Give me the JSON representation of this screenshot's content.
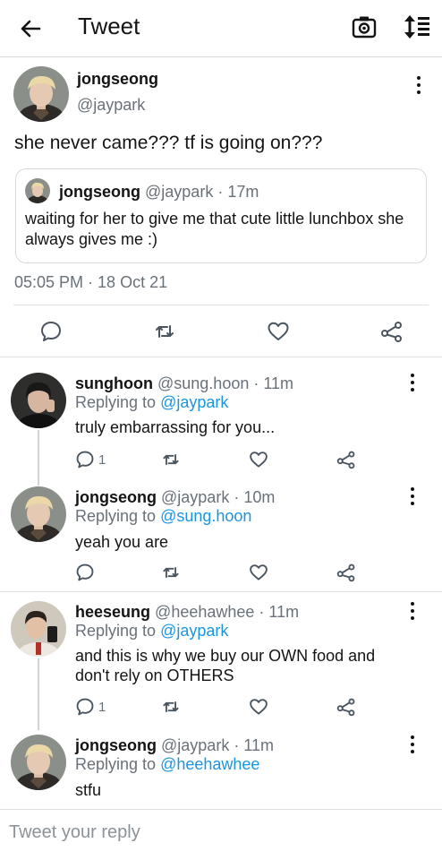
{
  "header": {
    "title": "Tweet"
  },
  "tweet": {
    "author_name": "jongseong",
    "author_handle": "@jaypark",
    "text": "she never came??? tf is going on???",
    "quoted": {
      "author_name": "jongseong",
      "author_handle": "@jaypark",
      "time": "· 17m",
      "text": "waiting for her to give me that cute little lunchbox she always gives me :)"
    },
    "timestamp": "05:05 PM · 18 Oct 21"
  },
  "replies": [
    {
      "name": "sunghoon",
      "handle": "@sung.hoon",
      "time": "· 11m",
      "replying_label": "Replying to",
      "replying_to": "@jaypark",
      "text": "truly embarrassing for you...",
      "reply_count": "1"
    },
    {
      "name": "jongseong",
      "handle": "@jaypark",
      "time": "· 10m",
      "replying_label": "Replying to",
      "replying_to": "@sung.hoon",
      "text": "yeah you are",
      "reply_count": ""
    },
    {
      "name": "heeseung",
      "handle": "@heehawhee",
      "time": "· 11m",
      "replying_label": "Replying to",
      "replying_to": "@jaypark",
      "text": "and this is why we buy our OWN food and don't rely on OTHERS",
      "reply_count": "1"
    },
    {
      "name": "jongseong",
      "handle": "@jaypark",
      "time": "· 11m",
      "replying_label": "Replying to",
      "replying_to": "@heehawhee",
      "text": "stfu",
      "reply_count": ""
    }
  ],
  "compose": {
    "placeholder": "Tweet your reply"
  },
  "icons": {
    "back": "arrow-left-icon",
    "camera": "camera-icon",
    "sort": "sort-icon",
    "more": "more-vertical-icon",
    "reply": "comment-icon",
    "retweet": "retweet-icon",
    "like": "heart-icon",
    "share": "share-icon"
  },
  "colors": {
    "link": "#1b95e0",
    "muted": "#69717a",
    "border": "#d6d9dc"
  }
}
